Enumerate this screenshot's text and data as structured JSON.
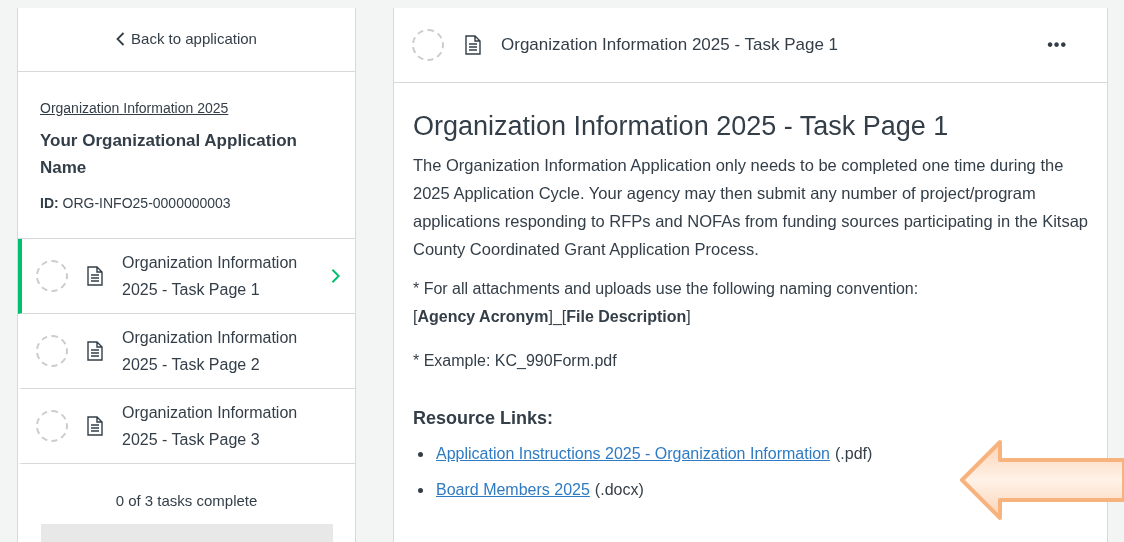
{
  "sidebar": {
    "back_link": "Back to application",
    "application": {
      "link": "Organization Information 2025",
      "name": "Your Organizational Application Name",
      "id_label": "ID:",
      "id_value": "ORG-INFO25-0000000003"
    },
    "tasks": [
      {
        "label": "Organization Information 2025 - Task Page 1",
        "selected": true,
        "complete": false
      },
      {
        "label": "Organization Information 2025 - Task Page 2",
        "selected": false,
        "complete": false
      },
      {
        "label": "Organization Information 2025 - Task Page 3",
        "selected": false,
        "complete": false
      }
    ],
    "progress": {
      "text": "0 of 3 tasks complete",
      "level": 0
    }
  },
  "main": {
    "header": {
      "title": "Organization Information 2025 - Task Page 1",
      "complete": false,
      "menu": "•••"
    },
    "heading": "Organization Information 2025 - Task Page 1",
    "intro": "The Organization Information Application only needs to be completed one time during the 2025 Application Cycle. Your agency may then submit any number of project/program applications responding to RFPs and NOFAs from funding sources participating in the Kitsap County Coordinated Grant Application Process.",
    "naming_note": "* For all attachments and uploads use the following naming convention:",
    "naming_pattern": "[**Agency Acronym**]_[**File Description**]",
    "example": "* Example: KC_990Form.pdf",
    "resources_heading": "Resource Links:",
    "resources": [
      {
        "link": "Application Instructions 2025 - Organization Information",
        "suffix": "(.pdf)"
      },
      {
        "link": "Board Members 2025",
        "suffix": "(.docx)"
      }
    ]
  }
}
